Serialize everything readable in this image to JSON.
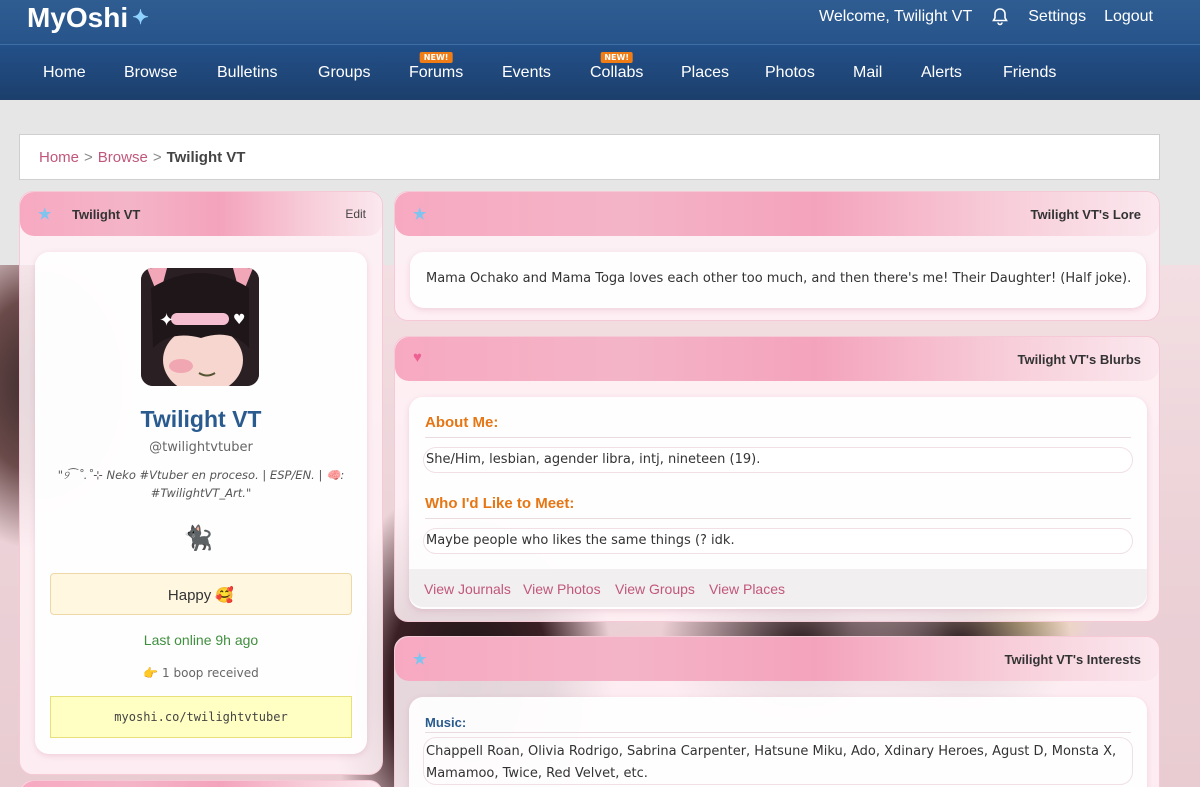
{
  "header": {
    "logo": "MyOshi",
    "welcome": "Welcome, Twilight VT",
    "settings": "Settings",
    "logout": "Logout"
  },
  "nav": {
    "items": [
      "Home",
      "Browse",
      "Bulletins",
      "Groups",
      "Forums",
      "Events",
      "Collabs",
      "Places",
      "Photos",
      "Mail",
      "Alerts",
      "Friends"
    ],
    "new_badge": "NEW!"
  },
  "breadcrumb": {
    "home": "Home",
    "browse": "Browse",
    "current": "Twilight VT",
    "separator": ">"
  },
  "profile": {
    "panel_title": "Twilight VT",
    "edit": "Edit",
    "display_name": "Twilight VT",
    "handle": "@twilightvtuber",
    "bio_line1": "\"୨⁀˚.˚⊹ Neko #Vtuber en proceso. | ESP/EN. | 🧠:",
    "bio_line2": "#TwilightVT_Art.\"",
    "cat_emoji": "🐈‍⬛",
    "mood": "Happy 🥰",
    "last_online": "Last online 9h ago",
    "boops": "👉 1 boop received",
    "url": "myoshi.co/twilightvtuber"
  },
  "lore": {
    "title": "Twilight VT's Lore",
    "text": "Mama Ochako and Mama Toga loves each other too much, and then there's me! Their Daughter! (Half joke)."
  },
  "blurbs": {
    "title": "Twilight VT's Blurbs",
    "about_label": "About Me:",
    "about_text": "She/Him, lesbian, agender libra, intj, nineteen (19).",
    "meet_label": "Who I'd Like to Meet:",
    "meet_text": "Maybe people who likes the same things (? idk.",
    "links": [
      "View Journals",
      "View Photos",
      "View Groups",
      "View Places"
    ]
  },
  "interests": {
    "title": "Twilight VT's Interests",
    "music_label": "Music:",
    "music_line1": "Chappell Roan, Olivia Rodrigo, Sabrina Carpenter, Hatsune Miku, Ado, Xdinary Heroes, Agust D, Monsta X,",
    "music_line2": "Mamamoo, Twice, Red Velvet, etc."
  },
  "colors": {
    "topbar": "#2f5d92",
    "nav": "#235089",
    "accent_link": "#c1577a",
    "section_label": "#e67613",
    "name_blue": "#2a5b8f"
  }
}
